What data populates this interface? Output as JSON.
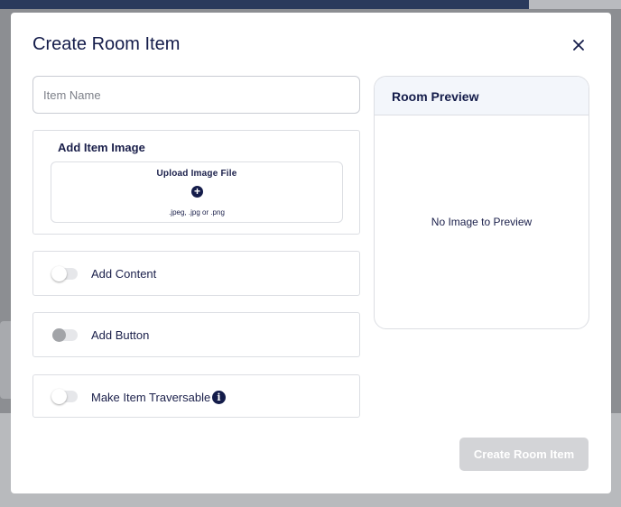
{
  "modal": {
    "title": "Create Room Item",
    "close_icon": "close-icon"
  },
  "item_name": {
    "placeholder": "Item Name",
    "value": ""
  },
  "image_section": {
    "heading": "Add Item Image",
    "upload_title": "Upload Image File",
    "upload_icon": "plus-circle-icon",
    "upload_hint": ".jpeg, .jpg or .png"
  },
  "toggles": {
    "content": {
      "label": "Add Content",
      "on": false
    },
    "button": {
      "label": "Add Button",
      "on": false
    },
    "traversable": {
      "label": "Make Item Traversable",
      "on": false,
      "info_icon": "info-icon"
    }
  },
  "preview": {
    "title": "Room Preview",
    "empty_text": "No Image to Preview"
  },
  "actions": {
    "create_label": "Create Room Item"
  },
  "colors": {
    "primary_text": "#141c4a",
    "disabled_button": "#d3d4d7",
    "preview_header": "#f3f6fb"
  }
}
